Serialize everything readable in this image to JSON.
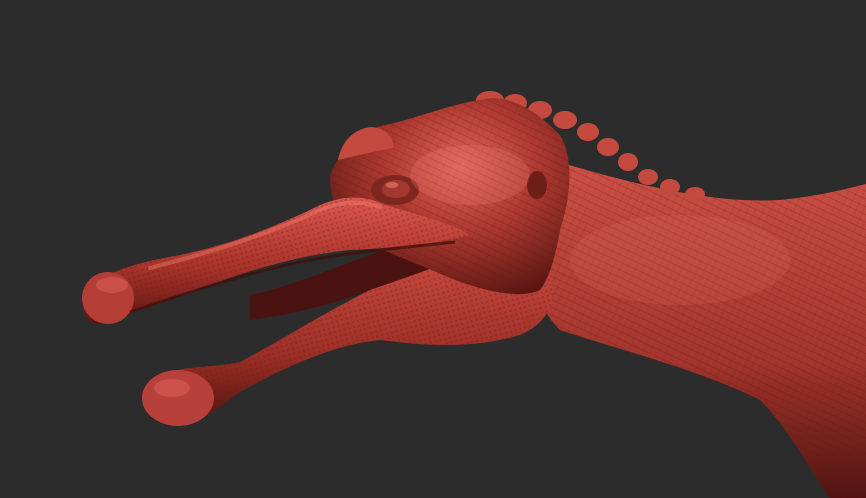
{
  "scene": {
    "subject": "sculpted-spinosaur-head",
    "background_color": "#2c2c2c",
    "material_base_color": "#b03a32",
    "material_highlight_color": "#e0645a",
    "material_shadow_color": "#5a1612",
    "mouth_interior_color": "#4a1210"
  }
}
